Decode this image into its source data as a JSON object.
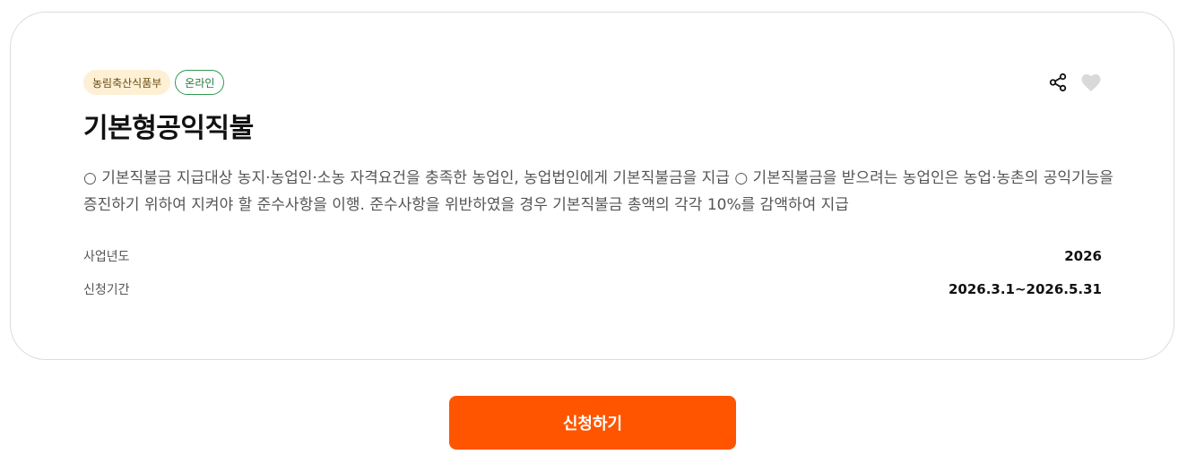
{
  "card": {
    "tags": {
      "ministry": "농림축산식품부",
      "channel": "온라인"
    },
    "title": "기본형공익직불",
    "description": "○ 기본직불금 지급대상 농지·농업인·소농 자격요건을 충족한 농업인, 농업법인에게 기본직불금을 지급 ○ 기본직불금을 받으려는 농업인은 농업·농촌의 공익기능을 증진하기 위하여 지켜야 할 준수사항을 이행. 준수사항을 위반하였을 경우 기본직불금 총액의 각각 10%를 감액하여 지급",
    "details": {
      "year_label": "사업년도",
      "year_value": "2026",
      "period_label": "신청기간",
      "period_value": "2026.3.1~2026.5.31"
    },
    "icons": {
      "share": "share-icon",
      "like": "heart-icon"
    }
  },
  "apply_button": {
    "label": "신청하기",
    "color": "#ff5500"
  },
  "colors": {
    "tag_ministry_bg": "#fdf0d5",
    "tag_online_border": "#2e9b4e",
    "heart_inactive": "#d9d9d9"
  }
}
